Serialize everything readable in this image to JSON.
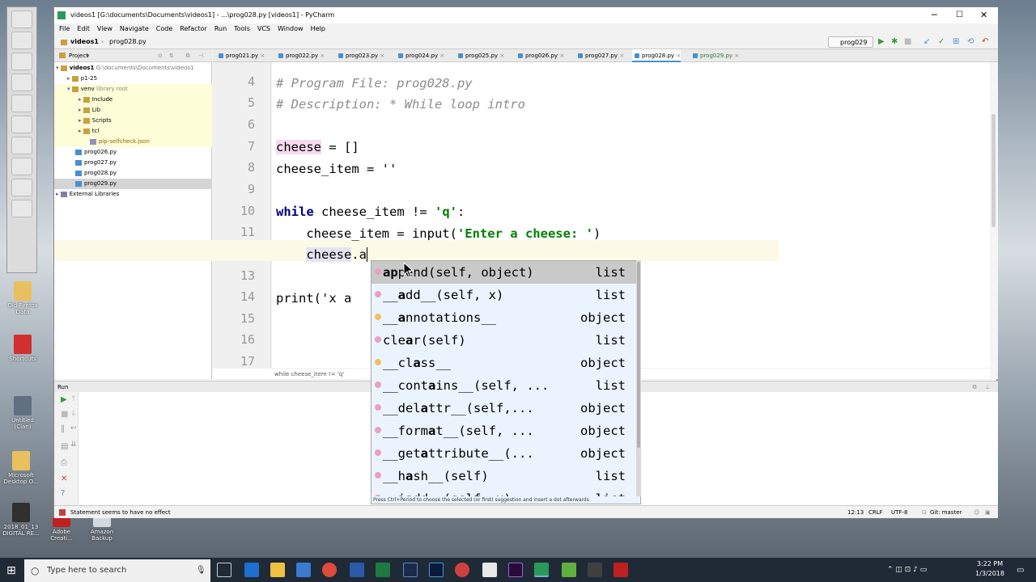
{
  "window": {
    "title": "videos1 [G:\\documents\\Documents\\videos1] - ...\\prog028.py [videos1] - PyCharm"
  },
  "menu": [
    "File",
    "Edit",
    "View",
    "Navigate",
    "Code",
    "Refactor",
    "Run",
    "Tools",
    "VCS",
    "Window",
    "Help"
  ],
  "nav": {
    "project": "videos1",
    "file": "prog028.py",
    "run_config": "prog029"
  },
  "project_panel": {
    "header": "Project",
    "items": [
      {
        "label": "videos1",
        "detail": "G:\\documents\\Documents\\videos1"
      },
      {
        "label": "p1-25"
      },
      {
        "label": "venv",
        "detail": "library root"
      },
      {
        "label": "Include"
      },
      {
        "label": "Lib"
      },
      {
        "label": "Scripts"
      },
      {
        "label": "tcl"
      },
      {
        "label": "pip-selfcheck.json"
      },
      {
        "label": "prog026.py"
      },
      {
        "label": "prog027.py"
      },
      {
        "label": "prog028.py"
      },
      {
        "label": "prog029.py"
      },
      {
        "label": "External Libraries"
      }
    ]
  },
  "tabs": [
    "prog021.py",
    "prog022.py",
    "prog023.py",
    "prog024.py",
    "prog025.py",
    "prog026.py",
    "prog027.py",
    "prog028.py",
    "prog029.py"
  ],
  "active_tab": "prog028.py",
  "editor": {
    "line_numbers": [
      "4",
      "5",
      "6",
      "7",
      "8",
      "9",
      "10",
      "11",
      "12",
      "13",
      "14",
      "15",
      "16",
      "17"
    ],
    "lines": {
      "l4": "# Program File: prog028.py",
      "l5": "# Description: * While loop intro",
      "l7a": "cheese",
      "l7b": " = []",
      "l8": "cheese_item = ''",
      "l10a": "while",
      "l10b": " cheese_item != ",
      "l10c": "'q'",
      "l10d": ":",
      "l11a": "    cheese_item = input(",
      "l11b": "'Enter a cheese: '",
      "l11c": ")",
      "l12a": "cheese",
      "l12b": ".a",
      "l14": "print('x a"
    },
    "breadcrumb": "while cheese_item != 'q'"
  },
  "completion": {
    "items": [
      {
        "pre": "",
        "bold": "ap",
        "rest": "pend(self, object)",
        "type": "list",
        "kind": "m"
      },
      {
        "pre": "__",
        "bold": "a",
        "rest": "dd__(self, x)",
        "type": "list",
        "kind": "m"
      },
      {
        "pre": "__",
        "bold": "a",
        "rest": "nnotations__",
        "type": "object",
        "kind": "f"
      },
      {
        "pre": "cle",
        "bold": "a",
        "rest": "r(self)",
        "type": "list",
        "kind": "m"
      },
      {
        "pre": "__cl",
        "bold": "a",
        "rest": "ss__",
        "type": "object",
        "kind": "f"
      },
      {
        "pre": "__cont",
        "bold": "a",
        "rest": "ins__(self, ...",
        "type": "list",
        "kind": "m"
      },
      {
        "pre": "__del",
        "bold": "a",
        "rest": "ttr__(self,...",
        "type": "object",
        "kind": "m"
      },
      {
        "pre": "__form",
        "bold": "a",
        "rest": "t__(self, ...",
        "type": "object",
        "kind": "m"
      },
      {
        "pre": "__get",
        "bold": "a",
        "rest": "ttribute__(...",
        "type": "object",
        "kind": "m"
      },
      {
        "pre": "__h",
        "bold": "a",
        "rest": "sh__(self)",
        "type": "list",
        "kind": "m"
      },
      {
        "pre": "__i",
        "bold": "a",
        "rest": "dd__(self, x)",
        "type": "list",
        "kind": "m"
      }
    ],
    "hint": "Press Ctrl+Period to choose the selected (or first) suggestion and insert a dot afterwards"
  },
  "run_panel": {
    "header": "Run"
  },
  "status": {
    "message": "Statement seems to have no effect",
    "position": "12:13",
    "line_sep": "CRLF",
    "encoding": "UTF-8",
    "vcs": "Git: master"
  },
  "desktop_icons": [
    "Old Firefox Data",
    "Shortcuts",
    "Untitled (Clan)",
    "Microsoft Desktop O...",
    "2018_01_13 DIGITAL RE...",
    "Adobe Creati...",
    "Amazon Backup"
  ],
  "taskbar": {
    "search_placeholder": "Type here to search",
    "time": "3:22 PM",
    "date": "1/3/2018"
  }
}
